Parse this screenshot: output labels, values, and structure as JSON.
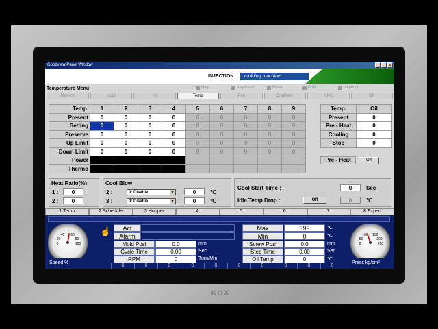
{
  "window": {
    "title": "Goodview Panel Window",
    "buttons": [
      "_",
      "□",
      "×"
    ]
  },
  "banner": {
    "injection": "INJECTION",
    "molding": "molding machine"
  },
  "menu": {
    "title": "Temperature Menu",
    "top_items": [
      "Help",
      "Keyboard",
      "Mode",
      "Print",
      "Network"
    ],
    "tabs": [
      "Monitor",
      "Mold",
      "Inj",
      "Temp",
      "Pen",
      "Engineer",
      "SPC",
      "DB"
    ],
    "active_tab": "Temp"
  },
  "temp_table": {
    "header_label": "Temp.",
    "zones": [
      "1",
      "2",
      "3",
      "4",
      "5",
      "6",
      "7",
      "8",
      "9"
    ],
    "rows": [
      {
        "label": "Present",
        "values": [
          "0",
          "0",
          "0",
          "0",
          "0",
          "0",
          "0",
          "0",
          "0"
        ]
      },
      {
        "label": "Setting",
        "values": [
          "0",
          "0",
          "0",
          "0",
          "0",
          "0",
          "0",
          "0",
          "0"
        ]
      },
      {
        "label": "Preserve",
        "values": [
          "0",
          "0",
          "0",
          "0",
          "0",
          "0",
          "0",
          "0",
          "0"
        ]
      },
      {
        "label": "Up Limit",
        "values": [
          "0",
          "0",
          "0",
          "0",
          "0",
          "0",
          "0",
          "0",
          "0"
        ]
      },
      {
        "label": "Down Limit",
        "values": [
          "0",
          "0",
          "0",
          "0",
          "0",
          "0",
          "0",
          "0",
          "0"
        ]
      }
    ],
    "power_label": "Power",
    "thermo_label": "Thermo"
  },
  "oil_panel": {
    "header": "Temp.",
    "header_val": "Oil",
    "rows": [
      {
        "label": "Present",
        "value": "0"
      },
      {
        "label": "Pre - Heat",
        "value": "0"
      },
      {
        "label": "Cooling",
        "value": "0"
      },
      {
        "label": "Stop",
        "value": "0"
      }
    ],
    "preheat_label": "Pre - Heat",
    "preheat_button": "Off"
  },
  "heat_ratio": {
    "title": "Heat Ratio(%)",
    "rows": [
      {
        "label": "1 :",
        "value": "0"
      },
      {
        "label": "2 :",
        "value": "0"
      }
    ]
  },
  "cool_blow": {
    "title": "Cool Blow",
    "rows": [
      {
        "label": "2 :",
        "select": "0: Disable",
        "value": "0",
        "unit": "℃"
      },
      {
        "label": "3 :",
        "select": "0: Disable",
        "value": "0",
        "unit": "℃"
      }
    ]
  },
  "cool_start": {
    "label": "Cool Start Time :",
    "value": "0",
    "unit": "Sec"
  },
  "idle_drop": {
    "label": "Idle Temp Drop :",
    "button": "Off",
    "value": "0",
    "unit": "℃"
  },
  "function_bar": [
    "1:Temp",
    "2:Schedule",
    "3:Hopper",
    "4:",
    "5:",
    "6:",
    "7:",
    "8:Expert"
  ],
  "status": {
    "act_label": "Act",
    "alarm_label": "Alarm",
    "max_label": "Max",
    "max_value": "399",
    "max_unit": "℃",
    "min_label": "Min",
    "min_value": "0",
    "min_unit": "℃",
    "mold_posi": {
      "label": "Mold Posi",
      "value": "0.0",
      "unit": "mm"
    },
    "cycle_time": {
      "label": "Cycle Time",
      "value": "0.00",
      "unit": "Sec"
    },
    "rpm": {
      "label": "RPM",
      "value": "0",
      "unit": "Turn/Min"
    },
    "screw_posi": {
      "label": "Screw Posi",
      "value": "0.0",
      "unit": "mm"
    },
    "step_time": {
      "label": "Step Time",
      "value": "0.00",
      "unit": "Sec"
    },
    "oil_temp": {
      "label": "Oil Temp",
      "value": "0",
      "unit": "℃"
    },
    "speed_gauge": {
      "label": "Speed %",
      "ticks": [
        "40",
        "60",
        "20",
        "80",
        "0",
        "100"
      ],
      "level": 0.55
    },
    "press_gauge": {
      "label": "Press kg/cm²",
      "ticks": [
        "100",
        "150",
        "50",
        "200",
        "0",
        "250"
      ],
      "level": 0.4
    },
    "bottom_zeros": [
      "0",
      "0",
      "0",
      "0",
      "0",
      "0",
      "0",
      "0",
      "0",
      "0"
    ]
  },
  "brand": "KOX"
}
